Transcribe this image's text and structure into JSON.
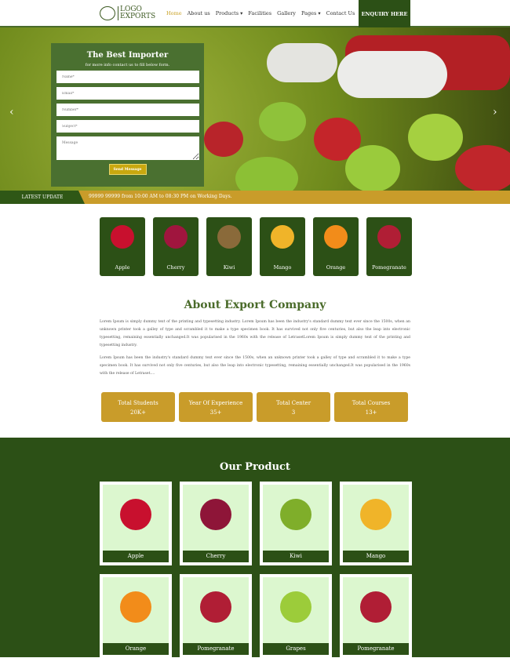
{
  "header": {
    "logo": "LOGO EXPORTS",
    "logo_line1": "LOGO",
    "logo_line2": "EXPORTS",
    "nav": [
      "Home",
      "About us",
      "Products ▾",
      "Facilities",
      "Gallery",
      "Pages ▾",
      "Contact Us"
    ],
    "enquiry": "ENQUIRY HERE"
  },
  "form": {
    "title": "The Best Importer",
    "subtitle": "for more info contact us to fill below form.",
    "name": "Name*",
    "email": "Email*",
    "number": "Number*",
    "subject": "Subject*",
    "message": "Message",
    "send": "Send Message"
  },
  "ticker": {
    "label": "LATEST UPDATE",
    "message": "99999 99999 from 10:00 AM to 08:30 PM on Working Days."
  },
  "categories": [
    {
      "label": "Apple",
      "color": "#c8102e"
    },
    {
      "label": "Cherry",
      "color": "#a0153e"
    },
    {
      "label": "Kiwi",
      "color": "#8a6a3a"
    },
    {
      "label": "Mango",
      "color": "#f0b429"
    },
    {
      "label": "Orange",
      "color": "#f28c1a"
    },
    {
      "label": "Pomegranate",
      "color": "#b01e35"
    }
  ],
  "about": {
    "title": "About Export Company",
    "p1": "Lorem Ipsum is simply dummy text of the printing and typesetting industry. Lorem Ipsum has been the industry's standard dummy text ever since the 1500s, when an unknown printer took a galley of type and scrambled it to make a type specimen book. It has survived not only five centuries, but also the leap into electronic typesetting, remaining essentially unchanged.It was popularised in the 1960s with the release of LetrasetLorem Ipsum is simply dummy text of the printing and typesetting industry.",
    "p2": "Lorem Ipsum has been the industry's standard dummy text ever since the 1500s, when an unknown printer took a galley of type and scrambled it to make a type specimen book. It has survived not only five centuries, but also the leap into electronic typesetting, remaining essentially unchanged.It was popularised in the 1960s with the release of Letraset...."
  },
  "stats": [
    {
      "label": "Total Students",
      "value": "20K+"
    },
    {
      "label": "Year Of Experience",
      "value": "35+"
    },
    {
      "label": "Total Center",
      "value": "3"
    },
    {
      "label": "Total Courses",
      "value": "13+"
    }
  ],
  "products": {
    "title": "Our Product",
    "items": [
      {
        "label": "Apple",
        "color": "#c8102e"
      },
      {
        "label": "Cherry",
        "color": "#8e1538"
      },
      {
        "label": "Kiwi",
        "color": "#7fae2a"
      },
      {
        "label": "Mango",
        "color": "#f0b429"
      },
      {
        "label": "Orange",
        "color": "#f28c1a"
      },
      {
        "label": "Pomegranate",
        "color": "#b01e35"
      },
      {
        "label": "Grapes",
        "color": "#9ccc3a"
      },
      {
        "label": "Pomegranate",
        "color": "#b01e35"
      }
    ]
  },
  "colors": {
    "primary": "#2c5016",
    "accent": "#c99c2a"
  }
}
